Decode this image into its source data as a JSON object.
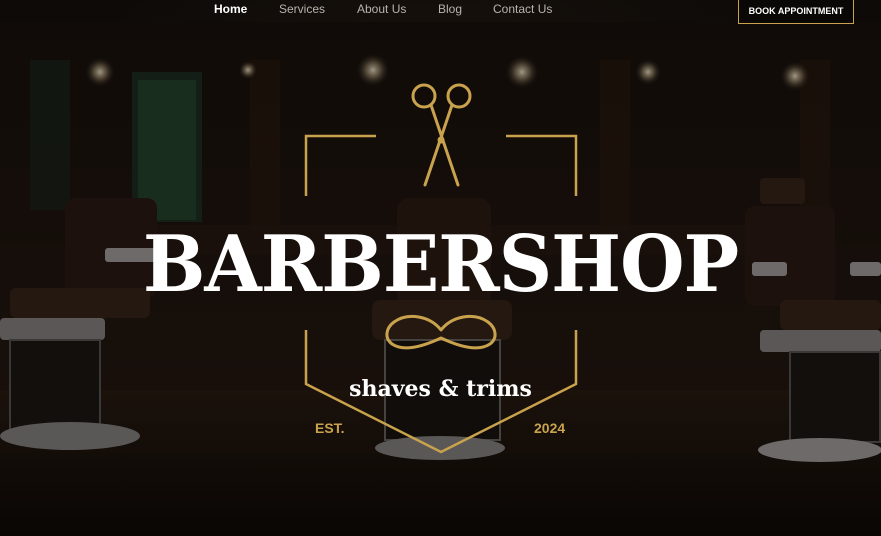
{
  "nav": {
    "items": [
      {
        "label": "Home",
        "active": true
      },
      {
        "label": "Services",
        "active": false
      },
      {
        "label": "About Us",
        "active": false
      },
      {
        "label": "Blog",
        "active": false
      },
      {
        "label": "Contact Us",
        "active": false
      }
    ],
    "cta_label": "BOOK APPOINTMENT"
  },
  "hero": {
    "brand": "BARBERSHOP",
    "tagline": "shaves & trims",
    "est_label": "EST.",
    "year": "2024"
  },
  "colors": {
    "accent_gold": "#c9a24d",
    "text_white": "#ffffff",
    "background": "#0b0807"
  },
  "icons": {
    "emblem_top": "scissors-icon",
    "emblem_middle": "mustache-icon"
  }
}
